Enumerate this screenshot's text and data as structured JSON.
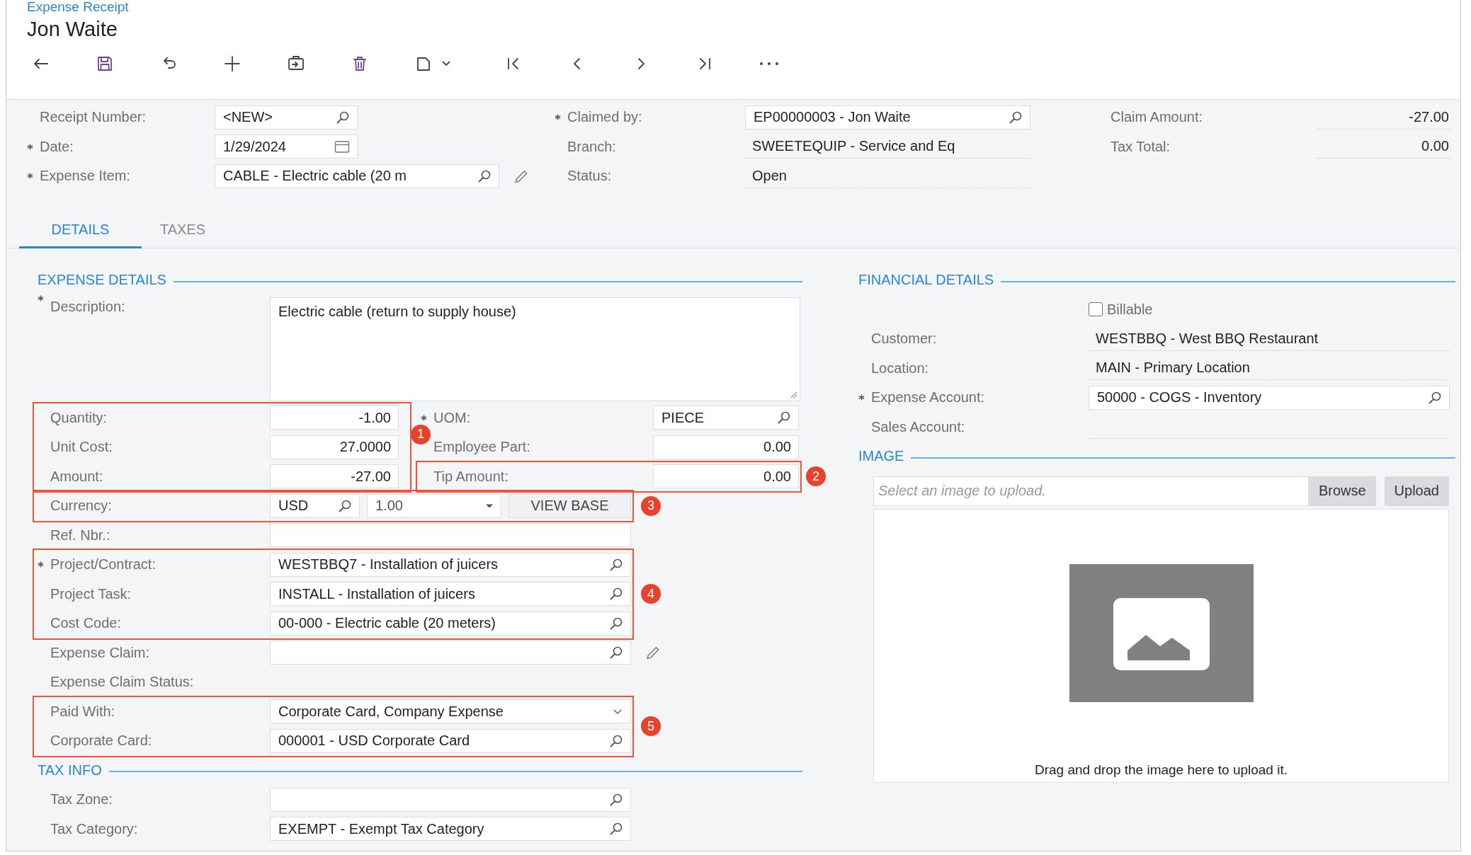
{
  "breadcrumb": "Expense Receipt",
  "title": "Jon Waite",
  "header": {
    "columns": [
      [
        {
          "kind": "lookup",
          "label": "Receipt Number:",
          "required": false,
          "value": "<NEW>"
        },
        {
          "kind": "date",
          "label": "Date:",
          "required": true,
          "value": "1/29/2024"
        },
        {
          "kind": "lookup",
          "label": "Expense Item:",
          "required": true,
          "value": "CABLE - Electric cable (20 m",
          "edit": true
        }
      ],
      [
        {
          "kind": "lookup",
          "label": "Claimed by:",
          "required": true,
          "value": "EP00000003 - Jon Waite"
        },
        {
          "kind": "display",
          "label": "Branch:",
          "required": false,
          "value": "SWEETEQUIP - Service and Eq"
        },
        {
          "kind": "display",
          "label": "Status:",
          "required": false,
          "value": "Open"
        }
      ],
      [
        {
          "kind": "amount",
          "label": "Claim Amount:",
          "required": false,
          "value": "-27.00"
        },
        {
          "kind": "amount",
          "label": "Tax Total:",
          "required": false,
          "value": "0.00"
        }
      ]
    ]
  },
  "tabs": [
    {
      "label": "DETAILS",
      "selected": true
    },
    {
      "label": "TAXES",
      "selected": false
    }
  ],
  "expense_details": {
    "title": "EXPENSE DETAILS",
    "items": [
      {
        "kind": "textarea",
        "label": "Description:",
        "required": true,
        "value": "Electric cable (return to supply house)"
      },
      {
        "kind": "pair",
        "annotation": "1",
        "left": [
          {
            "kind": "number",
            "label": "Quantity:",
            "required": false,
            "value": "-1.00"
          },
          {
            "kind": "number",
            "label": "Unit Cost:",
            "required": false,
            "value": "27.0000"
          },
          {
            "kind": "number",
            "label": "Amount:",
            "required": false,
            "value": "-27.00"
          }
        ],
        "right": [
          {
            "kind": "lookup",
            "label": "UOM:",
            "required": true,
            "value": "PIECE"
          },
          {
            "kind": "number",
            "label": "Employee Part:",
            "required": false,
            "value": "0.00"
          },
          {
            "kind": "number",
            "label": "Tip Amount:",
            "required": false,
            "value": "0.00",
            "annotation": "2"
          }
        ]
      },
      {
        "kind": "currency",
        "label": "Currency:",
        "required": false,
        "annotation": "3",
        "value": "USD",
        "rate": "1.00",
        "button": "VIEW BASE"
      },
      {
        "kind": "text",
        "label": "Ref. Nbr.:",
        "required": false
      },
      {
        "kind": "group",
        "annotation": "4",
        "fields": [
          {
            "kind": "lookup",
            "label": "Project/Contract:",
            "required": true,
            "value": "WESTBBQ7 - Installation of juicers"
          },
          {
            "kind": "lookup",
            "label": "Project Task:",
            "required": false,
            "value": "INSTALL - Installation of juicers"
          },
          {
            "kind": "lookup",
            "label": "Cost Code:",
            "required": false,
            "value": "00-000 - Electric cable (20 meters)"
          }
        ]
      },
      {
        "kind": "lookup",
        "label": "Expense Claim:",
        "required": false,
        "edit": true
      },
      {
        "kind": "static",
        "label": "Expense Claim Status:",
        "required": false
      },
      {
        "kind": "group",
        "annotation": "5",
        "fields": [
          {
            "kind": "dropdown",
            "label": "Paid With:",
            "required": false,
            "value": "Corporate Card, Company Expense"
          },
          {
            "kind": "lookup",
            "label": "Corporate Card:",
            "required": false,
            "value": "000001 - USD Corporate Card"
          }
        ]
      }
    ]
  },
  "tax_info": {
    "title": "TAX INFO",
    "items": [
      {
        "kind": "lookup",
        "label": "Tax Zone:",
        "required": false
      },
      {
        "kind": "lookup",
        "label": "Tax Category:",
        "required": false,
        "value": "EXEMPT - Exempt Tax Category"
      }
    ]
  },
  "financial_details": {
    "title": "FINANCIAL DETAILS",
    "billable": {
      "label": "Billable",
      "checked": false
    },
    "items": [
      {
        "kind": "display",
        "label": "Customer:",
        "required": false,
        "value": "WESTBBQ - West BBQ Restaurant"
      },
      {
        "kind": "display",
        "label": "Location:",
        "required": false,
        "value": "MAIN - Primary Location"
      },
      {
        "kind": "lookup",
        "label": "Expense Account:",
        "required": true,
        "value": "50000 - COGS - Inventory"
      },
      {
        "kind": "display",
        "label": "Sales Account:",
        "required": false
      }
    ]
  },
  "image": {
    "title": "IMAGE",
    "placeholder": "Select an image to upload.",
    "buttons": [
      "Browse",
      "Upload"
    ],
    "drop_text": "Drag and drop the image here to upload it."
  }
}
